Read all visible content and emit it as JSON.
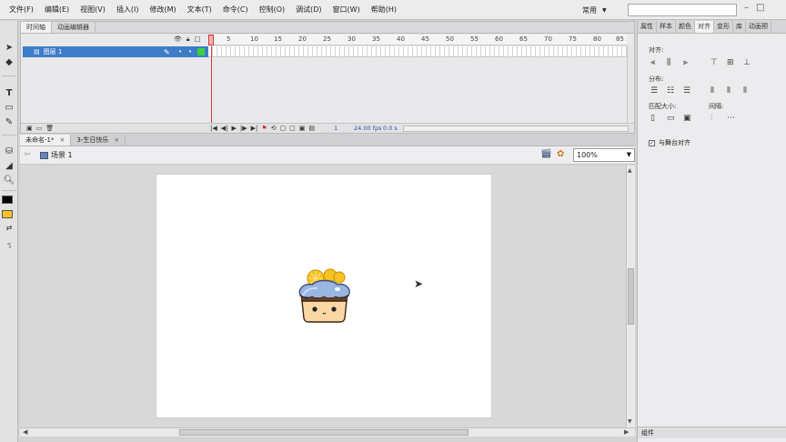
{
  "menubar": {
    "items": [
      "文件(F)",
      "编辑(E)",
      "视图(V)",
      "插入(I)",
      "修改(M)",
      "文本(T)",
      "命令(C)",
      "控制(O)",
      "调试(D)",
      "窗口(W)",
      "帮助(H)"
    ],
    "workspace": "常用"
  },
  "timeline": {
    "tabs": [
      "时间轴",
      "动画编辑器"
    ],
    "frame_numbers": [
      "1",
      "5",
      "10",
      "15",
      "20",
      "25",
      "30",
      "35",
      "40",
      "45",
      "50",
      "55",
      "60",
      "65",
      "70",
      "75",
      "80",
      "85"
    ],
    "layer_name": "图层 1",
    "current_frame": "1",
    "fps": "24.00 fps",
    "elapsed": "0.0 s"
  },
  "document_tabs": [
    {
      "label": "未命名-1*",
      "close": "×"
    },
    {
      "label": "3-生日快乐",
      "close": "×"
    }
  ],
  "editbar": {
    "scene": "场景 1",
    "zoom": "100%"
  },
  "right_panel": {
    "tabs": [
      "属性",
      "样本",
      "颜色",
      "对齐",
      "变形",
      "库",
      "动画预"
    ],
    "align_label": "对齐:",
    "distribute_label": "分布:",
    "match_size_label": "匹配大小:",
    "spacing_label": "间隔:",
    "stage_align_label": "与舞台对齐",
    "footer_label": "组件"
  }
}
